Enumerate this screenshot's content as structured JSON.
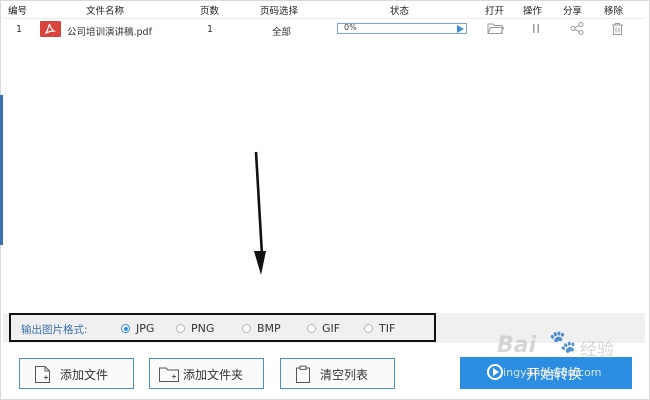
{
  "headers": {
    "index": "编号",
    "filename": "文件名称",
    "pages": "页数",
    "page_select": "页码选择",
    "status": "状态",
    "open": "打开",
    "operate": "操作",
    "share": "分享",
    "remove": "移除"
  },
  "files": [
    {
      "index": "1",
      "name": "公司培训演讲稿.pdf",
      "pages": "1",
      "page_select": "全部",
      "progress_text": "0%",
      "progress": 0.0
    }
  ],
  "format": {
    "label": "输出图片格式:",
    "options": [
      "JPG",
      "PNG",
      "BMP",
      "GIF",
      "TIF"
    ],
    "selected": "JPG"
  },
  "buttons": {
    "add_file": "添加文件",
    "add_folder": "添加文件夹",
    "clear_list": "清空列表",
    "start": "开始转换"
  },
  "watermark": {
    "brand": "Bai",
    "brand_cn": "经验",
    "url": "jingyan.baidu.com"
  },
  "colors": {
    "accent": "#2b8ee3",
    "pdf_red": "#d9453d",
    "label_blue": "#3a6fb0"
  }
}
